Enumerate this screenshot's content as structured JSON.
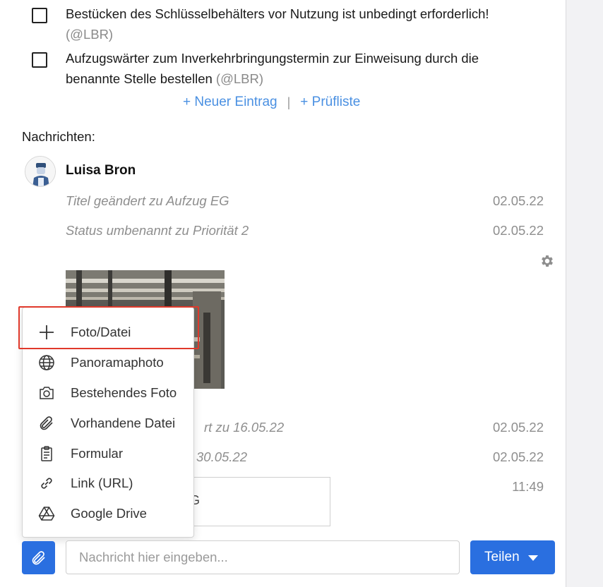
{
  "checklist": [
    {
      "text": "Bestücken des Schlüsselbehälters vor Nutzung ist unbedingt erforderlich!",
      "mention": "(@LBR)"
    },
    {
      "text": "Aufzugswärter zum Inverkehrbringungstermin zur Einweisung durch die benannte Stelle bestellen",
      "mention": "(@LBR)"
    }
  ],
  "add_links": {
    "new_entry": "+ Neuer Eintrag",
    "separator": "|",
    "checklist": "+ Prüfliste"
  },
  "messages": {
    "heading": "Nachrichten:",
    "author": "Luisa Bron",
    "activities": [
      {
        "text": "Titel geändert zu Aufzug EG",
        "date": "02.05.22"
      },
      {
        "text": "Status umbenannt zu Priorität 2",
        "date": "02.05.22"
      },
      {
        "text": "rt zu 16.05.22",
        "date": "02.05.22"
      },
      {
        "text": "30.05.22",
        "date": "02.05.22"
      },
      {
        "text": "",
        "date": "11:49"
      }
    ],
    "file_fragment": "G"
  },
  "dropdown": {
    "items": [
      {
        "label": "Foto/Datei",
        "icon": "plus-icon"
      },
      {
        "label": "Panoramaphoto",
        "icon": "globe-icon"
      },
      {
        "label": "Bestehendes Foto",
        "icon": "camera-icon"
      },
      {
        "label": "Vorhandene Datei",
        "icon": "paperclip-icon"
      },
      {
        "label": "Formular",
        "icon": "clipboard-icon"
      },
      {
        "label": "Link (URL)",
        "icon": "link-icon"
      },
      {
        "label": "Google Drive",
        "icon": "google-drive-icon"
      }
    ]
  },
  "composer": {
    "placeholder": "Nachricht hier eingeben...",
    "share_label": "Teilen"
  },
  "colors": {
    "accent": "#2a6fe0",
    "link": "#4a90e2",
    "highlight": "#e0392b"
  }
}
